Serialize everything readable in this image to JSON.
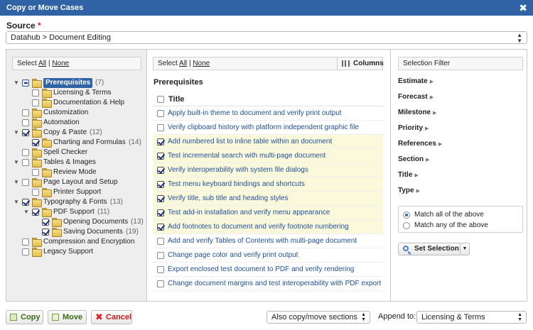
{
  "dialog": {
    "title": "Copy or Move Cases",
    "close_glyph": "✖"
  },
  "source": {
    "label": "Source",
    "required_mark": "*",
    "value": "Datahub > Document Editing"
  },
  "tree": {
    "select_label": "Select",
    "all": "All",
    "separator": "|",
    "none": "None",
    "nodes": [
      {
        "label": "Prerequisites",
        "count": "(7)",
        "state": "partial",
        "selected": true,
        "twist": "▼"
      },
      {
        "label": "Licensing & Terms",
        "count": "",
        "state": "off"
      },
      {
        "label": "Documentation & Help",
        "count": "",
        "state": "off"
      },
      {
        "label": "Customization",
        "count": "",
        "state": "off"
      },
      {
        "label": "Automation",
        "count": "",
        "state": "off"
      },
      {
        "label": "Copy & Paste",
        "count": "(12)",
        "state": "on",
        "twist": "▼"
      },
      {
        "label": "Charting and Formulas",
        "count": "(14)",
        "state": "on"
      },
      {
        "label": "Spell Checker",
        "count": "",
        "state": "off"
      },
      {
        "label": "Tables & Images",
        "count": "",
        "state": "off",
        "twist": "▼"
      },
      {
        "label": "Review Mode",
        "count": "",
        "state": "off"
      },
      {
        "label": "Page Layout and Setup",
        "count": "",
        "state": "off",
        "twist": "▼"
      },
      {
        "label": "Printer Support",
        "count": "",
        "state": "off"
      },
      {
        "label": "Typography & Fonts",
        "count": "(13)",
        "state": "on",
        "twist": "▼"
      },
      {
        "label": "PDF Support",
        "count": "(11)",
        "state": "on",
        "twist": "▼"
      },
      {
        "label": "Opening Documents",
        "count": "(13)",
        "state": "on"
      },
      {
        "label": "Saving Documents",
        "count": "(19)",
        "state": "on"
      },
      {
        "label": "Compression and Encryption",
        "count": "",
        "state": "off"
      },
      {
        "label": "Legacy Support",
        "count": "",
        "state": "off"
      }
    ]
  },
  "cases": {
    "select_label": "Select",
    "all": "All",
    "separator": "|",
    "none": "None",
    "columns_label": "Columns",
    "section_title": "Prerequisites",
    "header_title": "Title",
    "rows": [
      {
        "title": "Apply built-in theme to document and verify print output",
        "checked": false
      },
      {
        "title": "Verify clipboard history with platform independent graphic file",
        "checked": false
      },
      {
        "title": "Add numbered list to inline table within an document",
        "checked": true
      },
      {
        "title": "Test incremental search with multi-page document",
        "checked": true
      },
      {
        "title": "Verify interoperability with system file dialogs",
        "checked": true
      },
      {
        "title": "Test menu keyboard bindings and shortcuts",
        "checked": true
      },
      {
        "title": "Verify title, sub title and heading styles",
        "checked": true
      },
      {
        "title": "Test add-in installation and verify menu appearance",
        "checked": true
      },
      {
        "title": "Add footnotes to document and verify footnote numbering",
        "checked": true
      },
      {
        "title": "Add and verify Tables of Contents with multi-page document",
        "checked": false
      },
      {
        "title": "Change page color and verify print output",
        "checked": false
      },
      {
        "title": "Export enclosed test document to PDF and verify rendering",
        "checked": false
      },
      {
        "title": "Change document margins and test interoperability with PDF export",
        "checked": false
      }
    ]
  },
  "filter": {
    "header": "Selection Filter",
    "items": [
      "Estimate",
      "Forecast",
      "Milestone",
      "Priority",
      "References",
      "Section",
      "Title",
      "Type"
    ],
    "match_all": "Match all of the above",
    "match_any": "Match any of the above",
    "match_mode": "all",
    "set_selection": "Set Selection"
  },
  "footer": {
    "copy": "Copy",
    "move": "Move",
    "cancel": "Cancel",
    "sections_option": "Also copy/move sections",
    "append_label": "Append to:",
    "append_value": "Licensing & Terms"
  }
}
